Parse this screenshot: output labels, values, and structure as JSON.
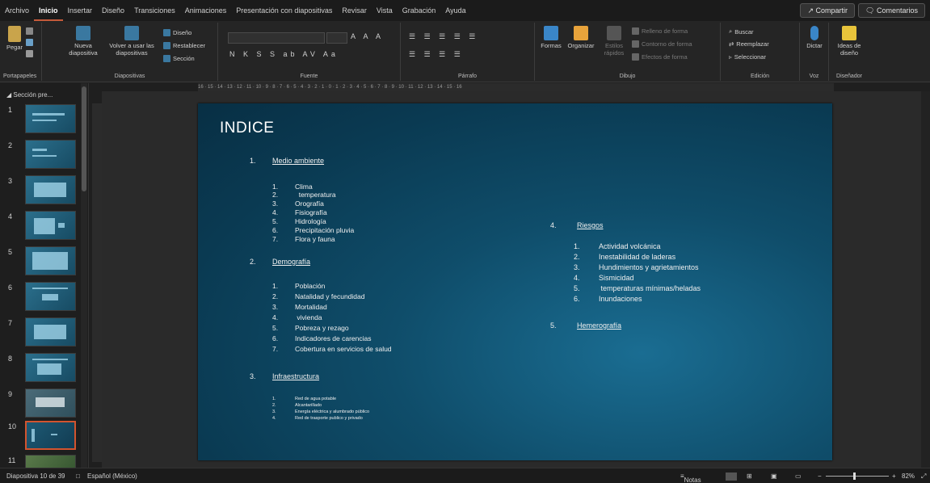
{
  "tabs": [
    "Archivo",
    "Inicio",
    "Insertar",
    "Diseño",
    "Transiciones",
    "Animaciones",
    "Presentación con diapositivas",
    "Revisar",
    "Vista",
    "Grabación",
    "Ayuda"
  ],
  "share": "Compartir",
  "comments": "Comentarios",
  "ribbon": {
    "paste": "Pegar",
    "clipboard": "Portapapeles",
    "new_slide": "Nueva diapositiva",
    "reuse": "Volver a usar las diapositivas",
    "layout": "Diseño",
    "reset": "Restablecer",
    "section": "Sección",
    "slides_group": "Diapositivas",
    "font_group": "Fuente",
    "format_row": "N K S S ab AV Aa",
    "paragraph_group": "Párrafo",
    "shapes": "Formas",
    "arrange": "Organizar",
    "quick_styles": "Estilos rápidos",
    "shape_fill": "Relleno de forma",
    "shape_outline": "Contorno de forma",
    "shape_effects": "Efectos de forma",
    "drawing_group": "Dibujo",
    "find": "Buscar",
    "replace": "Reemplazar",
    "select": "Seleccionar",
    "editing_group": "Edición",
    "dictate": "Dictar",
    "voice_group": "Voz",
    "designer": "Ideas de diseño",
    "designer_group": "Diseñador"
  },
  "ruler": "16 · 15 · 14 · 13 · 12 · 11 · 10 · 9 · 8 · 7 · 6 · 5 · 4 · 3 · 2 · 1 · 0 · 1 · 2 · 3 · 4 · 5 · 6 · 7 · 8 · 9 · 10 · 11 · 12 · 13 · 14 · 15 · 16",
  "thumbnails": {
    "section": "Sección pre...",
    "slides": [
      "1",
      "2",
      "3",
      "4",
      "5",
      "6",
      "7",
      "8",
      "9",
      "10",
      "11"
    ]
  },
  "slide": {
    "title": "INDICE",
    "s1": {
      "n": "1.",
      "title": "Medio ambiente",
      "items": [
        [
          "1.",
          "Clima"
        ],
        [
          "2.",
          "  temperatura"
        ],
        [
          "3.",
          "Orografía"
        ],
        [
          "4.",
          "Fisiografía"
        ],
        [
          "5.",
          "Hidrología"
        ],
        [
          "6.",
          "Precipitación pluvia"
        ],
        [
          "7.",
          "Flora y fauna"
        ]
      ]
    },
    "s2": {
      "n": "2.",
      "title": "Demografía",
      "items": [
        [
          "1.",
          "Población"
        ],
        [
          "2.",
          "Natalidad y fecundidad"
        ],
        [
          "3.",
          "Mortalidad"
        ],
        [
          "4.",
          " vivienda"
        ],
        [
          "5.",
          "Pobreza y rezago"
        ],
        [
          "6.",
          "Indicadores de carencias"
        ],
        [
          "7.",
          "Cobertura en servicios de salud"
        ]
      ]
    },
    "s3": {
      "n": "3.",
      "title": "Infraestructura",
      "items": [
        [
          "1.",
          "Red de agua potable"
        ],
        [
          "2.",
          "Alcantarillado"
        ],
        [
          "3.",
          "Energía eléctrica y alumbrado público"
        ],
        [
          "4.",
          "Red de trasporte publico y privado"
        ]
      ]
    },
    "s4": {
      "n": "4.",
      "title": "Riesgos",
      "items": [
        [
          "1.",
          "Actividad volcánica"
        ],
        [
          "2.",
          "Inestabilidad de laderas"
        ],
        [
          "3.",
          "Hundimientos y agrietamientos"
        ],
        [
          "4.",
          "Sismicidad"
        ],
        [
          "5.",
          " temperaturas mínimas/heladas"
        ],
        [
          "6.",
          "Inundaciones"
        ]
      ]
    },
    "s5": {
      "n": "5.",
      "title": "Hemerografía"
    }
  },
  "status": {
    "slide_count": "Diapositiva 10 de 39",
    "language": "Español (México)",
    "notes": "Notas",
    "zoom": "82%"
  }
}
